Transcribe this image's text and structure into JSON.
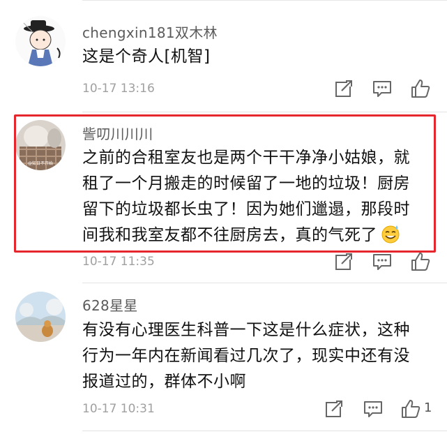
{
  "comments": [
    {
      "username": "chengxin181双木林",
      "text_lines": [
        "这是个奇人[机智]"
      ],
      "time": "10-17 13:16",
      "like_count": ""
    },
    {
      "username": "訾叨川川川",
      "text_lines": [
        "之前的合租室友也是两个干干净净小姑娘，就",
        "租了一个月搬走的时候留了一地的垃圾！厨房",
        "留下的垃圾都长虫了！因为她们邋遢，那段时",
        "间我和我室友都不往厨房去，真的气死了"
      ],
      "emoji": "sweat-smile-emoji",
      "avatar_watermark": "@知日不开始",
      "time": "10-17 11:35",
      "like_count": ""
    },
    {
      "username": "628星星",
      "text_lines": [
        "有没有心理医生科普一下这是什么症状，这种",
        "行为一年内在新闻看过几次了，现实中还有没",
        "报道过的，群体不小啊"
      ],
      "time": "10-17 10:31",
      "like_count": "1"
    }
  ],
  "icons": {
    "share": "share-icon",
    "comment": "comment-icon",
    "like": "thumbs-up-icon"
  },
  "colors": {
    "highlight_border": "#e6262d",
    "username": "#5b5b5b",
    "timestamp": "#a0a0a0"
  }
}
